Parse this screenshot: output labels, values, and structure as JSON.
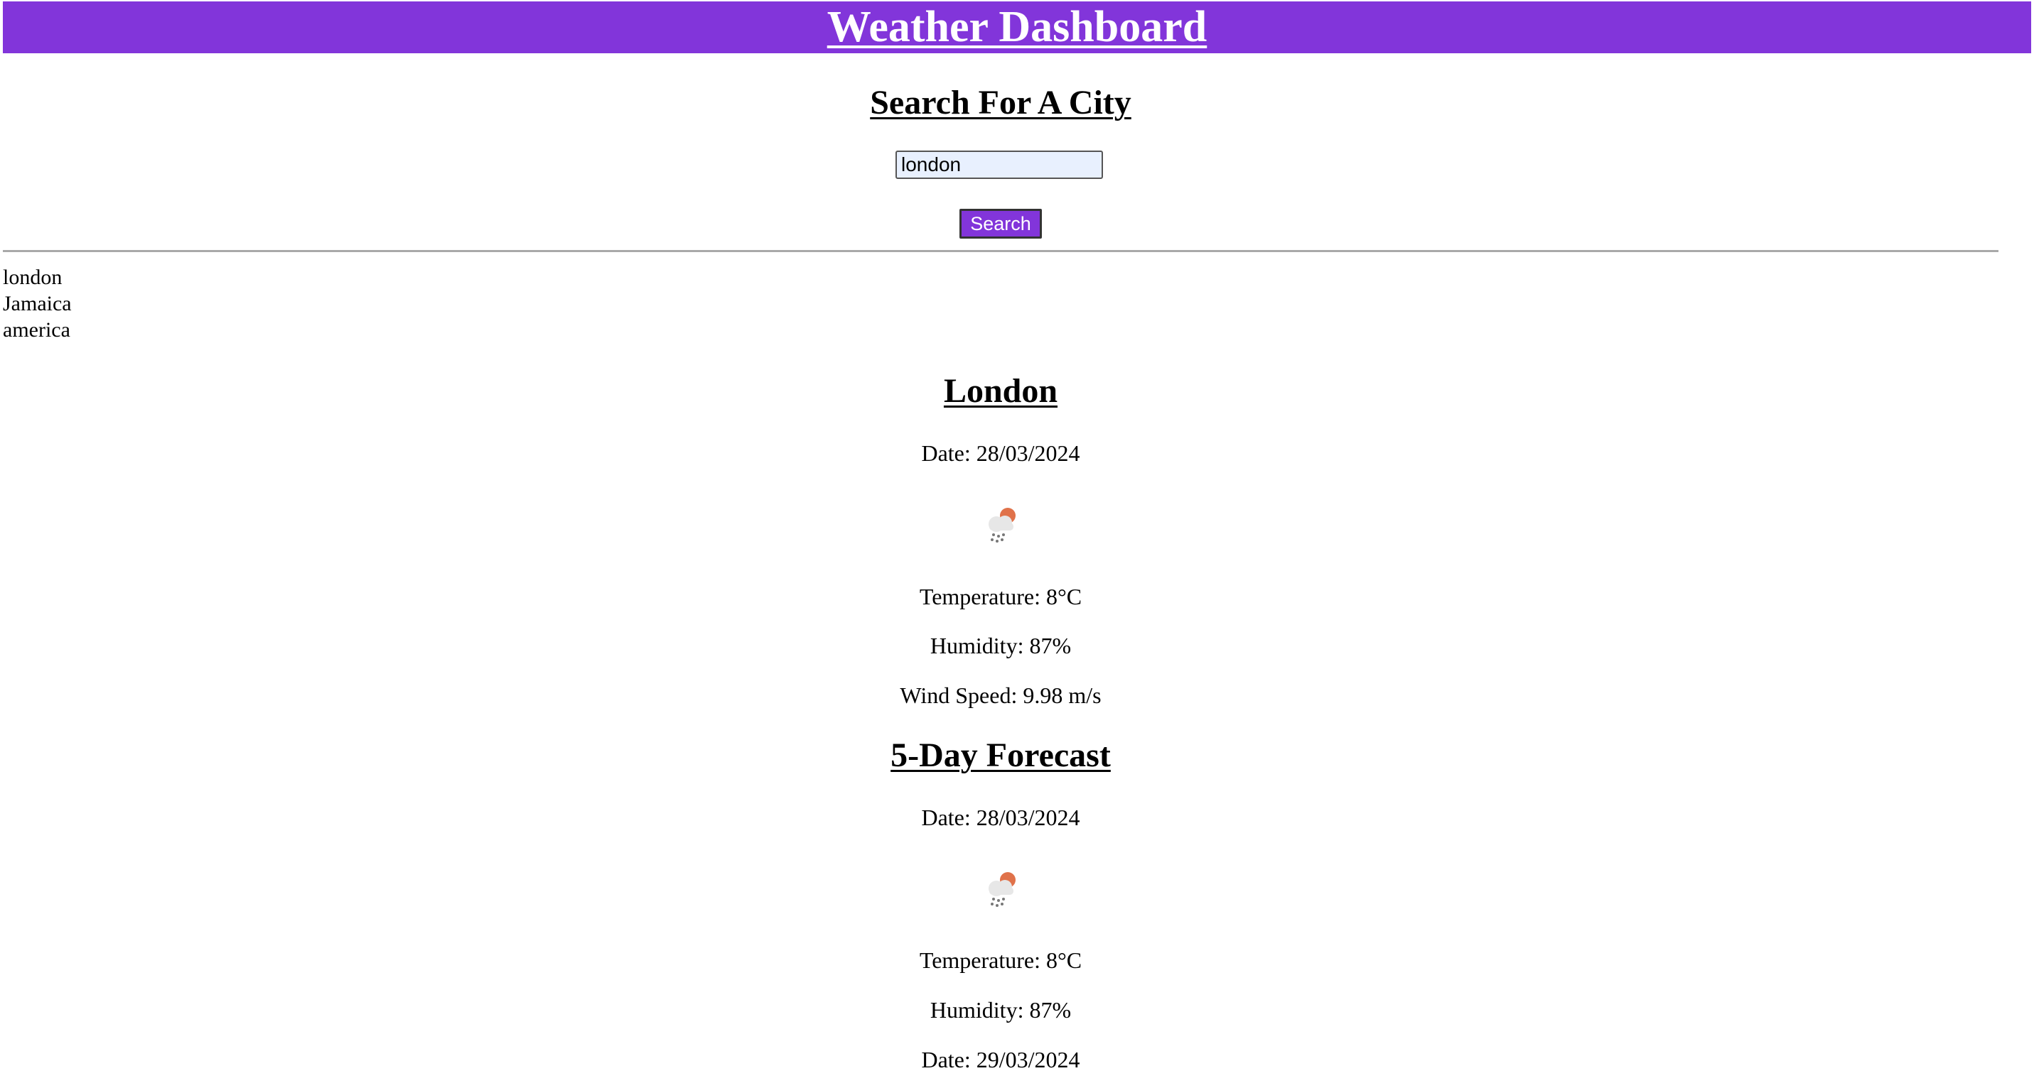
{
  "header": {
    "title": "Weather Dashboard"
  },
  "search": {
    "title": "Search For A City",
    "input_value": "london",
    "button_label": "Search"
  },
  "history": {
    "items": [
      "london",
      "Jamaica",
      "america"
    ]
  },
  "current": {
    "city": "London",
    "date": "Date: 28/03/2024",
    "icon": "light-rain-sun-icon",
    "temperature": "Temperature: 8°C",
    "humidity": "Humidity: 87%",
    "wind": "Wind Speed: 9.98 m/s"
  },
  "forecast": {
    "title": "5-Day Forecast",
    "days": [
      {
        "date": "Date: 28/03/2024",
        "icon": "light-rain-sun-icon",
        "temperature": "Temperature: 8°C",
        "humidity": "Humidity: 87%"
      },
      {
        "date": "Date: 29/03/2024"
      }
    ]
  },
  "colors": {
    "accent": "#8235da",
    "sun": "#e0724a",
    "cloud": "#e7e7e7",
    "rain": "#777777"
  }
}
